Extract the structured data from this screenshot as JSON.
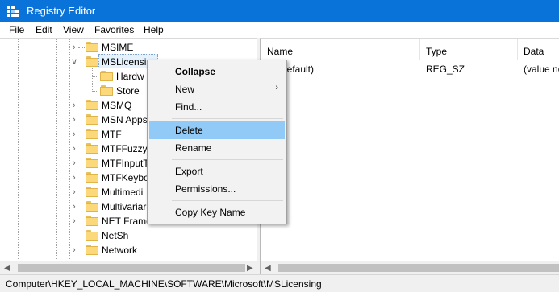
{
  "window": {
    "title": "Registry Editor",
    "title_bar_color": "#0a73d9"
  },
  "menubar": {
    "file": "File",
    "edit": "Edit",
    "view": "View",
    "favorites": "Favorites",
    "help": "Help"
  },
  "tree": {
    "items": [
      {
        "label": "MSIME"
      },
      {
        "label": "MSLicensing"
      },
      {
        "label": "Hardw"
      },
      {
        "label": "Store"
      },
      {
        "label": "MSMQ"
      },
      {
        "label": "MSN Apps"
      },
      {
        "label": "MTF"
      },
      {
        "label": "MTFFuzzyF"
      },
      {
        "label": "MTFInputT"
      },
      {
        "label": "MTFKeybo"
      },
      {
        "label": "Multimedi"
      },
      {
        "label": "Multivariar"
      },
      {
        "label": "NET Framew"
      },
      {
        "label": "NetSh"
      },
      {
        "label": "Network"
      }
    ]
  },
  "list": {
    "columns": {
      "name": "Name",
      "type": "Type",
      "data": "Data"
    },
    "rows": [
      {
        "name": "(Default)",
        "type": "REG_SZ",
        "data": "(value no"
      }
    ]
  },
  "context_menu": {
    "collapse": "Collapse",
    "new": "New",
    "find": "Find...",
    "delete": "Delete",
    "rename": "Rename",
    "export": "Export",
    "permissions": "Permissions...",
    "copy_key_name": "Copy Key Name",
    "highlight_color": "#91c9f7"
  },
  "status": {
    "path": "Computer\\HKEY_LOCAL_MACHINE\\SOFTWARE\\Microsoft\\MSLicensing"
  }
}
